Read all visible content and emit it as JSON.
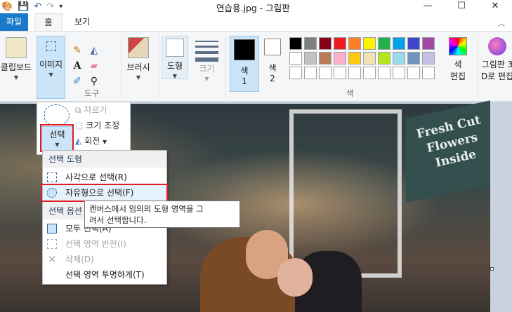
{
  "window": {
    "title": "연습용.jpg - 그림판",
    "controls": [
      "minimize-icon",
      "maximize-icon",
      "close-icon"
    ]
  },
  "tabs": [
    {
      "label": "파일",
      "active": false
    },
    {
      "label": "홈",
      "active": true
    },
    {
      "label": "보기",
      "active": false
    }
  ],
  "ribbon": {
    "clipboard_label": "클립보드",
    "image_label": "이미지",
    "tools_group_label": "도구",
    "brush_label": "브러시",
    "shapes_label": "도형",
    "size_label": "크기",
    "color1_label": "색",
    "color1_num": "1",
    "color2_label": "색",
    "color2_num": "2",
    "colors_group_label": "색",
    "edit_colors_line1": "색",
    "edit_colors_line2": "편집",
    "paint3d_line1": "그림판 3",
    "paint3d_line2": "D로 편집",
    "palette": [
      "#000000",
      "#7f7f7f",
      "#880015",
      "#ed1c24",
      "#ff7f27",
      "#fff200",
      "#22b14c",
      "#00a2e8",
      "#3f48cc",
      "#a349a4",
      "#ffffff",
      "#c3c3c3",
      "#b97a57",
      "#ffaec9",
      "#ffc90e",
      "#efe4b0",
      "#b5e61d",
      "#99d9ea",
      "#7092be",
      "#c8bfe7",
      "#ffffff",
      "#ffffff",
      "#ffffff",
      "#ffffff",
      "#ffffff",
      "#ffffff",
      "#ffffff",
      "#ffffff",
      "#ffffff",
      "#ffffff"
    ]
  },
  "image_panel": {
    "select_label": "선택",
    "crop_label": "자르기",
    "resize_label": "크기 조정",
    "rotate_label": "회전"
  },
  "select_menu": {
    "shapes_header": "선택 도형",
    "rect_select": "사각으로 선택(R)",
    "free_select": "자유형으로 선택(F)",
    "options_header": "선택 옵션",
    "select_all": "모두 선택(A)",
    "invert_select": "선택 영역 반전(I)",
    "delete": "삭제(D)",
    "transparent": "선택 영역 투명하게(T)"
  },
  "tooltip": {
    "line1": "캔버스에서 임의의 도형 영역을 그",
    "line2": "려서 선택합니다."
  },
  "photo": {
    "sign_line1": "Fresh Cut",
    "sign_line2": "Flowers",
    "sign_line3": "Inside"
  }
}
